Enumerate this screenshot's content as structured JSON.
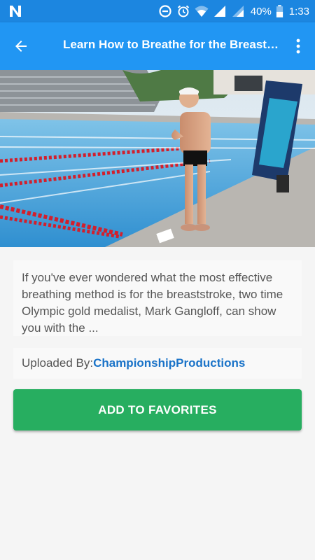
{
  "status_bar": {
    "battery": "40%",
    "time": "1:33",
    "icons": [
      "n-notification-icon",
      "data-saver-icon",
      "alarm-icon",
      "wifi-icon",
      "signal-icon",
      "signal-icon-2",
      "battery-icon"
    ]
  },
  "app_bar": {
    "title": "Learn How to Breathe for the Breaststroke",
    "back_icon": "arrow-back-icon",
    "menu_icon": "more-vert-icon",
    "color": "#2196f3"
  },
  "video": {
    "thumbnail_description_icon": "video-thumbnail"
  },
  "description": {
    "text": "If you've ever wondered what the most effective breathing method is for the breaststroke, two time Olympic gold medalist, Mark Gangloff, can show you with the ..."
  },
  "uploader": {
    "label": "Uploaded By:",
    "name": "ChampionshipProductions",
    "name_color": "#1a73c8"
  },
  "actions": {
    "favorite_label": "ADD TO FAVORITES",
    "favorite_color": "#27ae60"
  }
}
